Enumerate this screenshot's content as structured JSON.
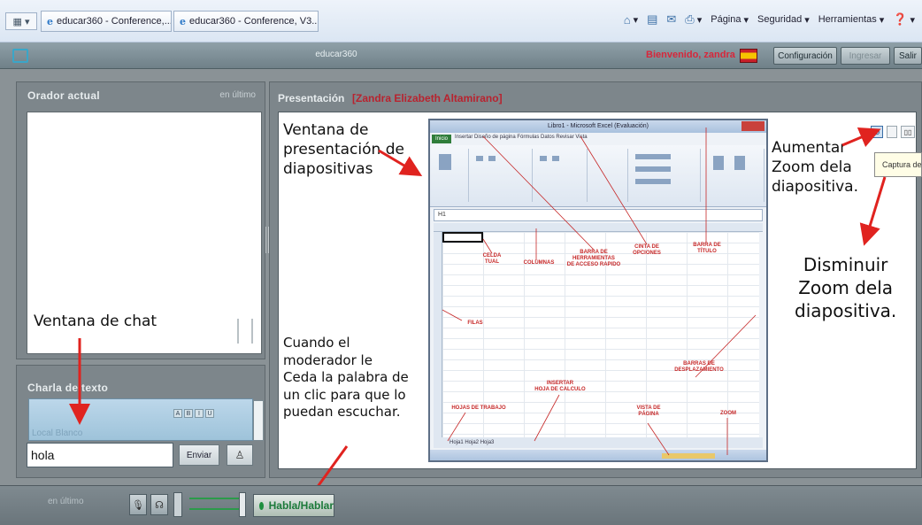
{
  "browser": {
    "tabs": [
      {
        "label": "educar360 - Conference,...",
        "close": "×"
      },
      {
        "label": "educar360 - Conference, V3..."
      }
    ],
    "commands": {
      "page": "Página",
      "security": "Seguridad",
      "tools": "Herramientas"
    }
  },
  "header": {
    "app_name": "educar360",
    "welcome": "Bienvenido, zandra",
    "settings_label": "Configuración",
    "button2_label": "Ingresar",
    "exit_label": "Salir"
  },
  "current_speaker": {
    "title": "Orador actual",
    "status": "en último"
  },
  "chat": {
    "title": "Charla de texto",
    "placeholder": "Local Blanco",
    "input_value": "hola",
    "send_label": "Enviar",
    "toolbar": [
      "A",
      "B",
      "I",
      "U"
    ]
  },
  "presentation": {
    "title": "Presentación",
    "presenter": "[Zandra Elizabeth Altamirano]",
    "tooltip": "Captura de"
  },
  "slide": {
    "window_title": "Libro1 - Microsoft Excel (Evaluación)",
    "home_tab": "Inicio",
    "tabs": "Insertar   Diseño de página   Fórmulas   Datos   Revisar   Vista",
    "name_box": "H1",
    "sheet_tabs": "Hoja1   Hoja2   Hoja3",
    "labels": {
      "celda": "CELDA\nTUAL",
      "columnas": "COLUMNAS",
      "barra_acceso": "BARRA DE\nHERRAMIENTAS\nDE ACCESO RAPIDO",
      "cinta": "CINTA DE\nOPCIONES",
      "barra_titulo": "BARRA DE\nTÍTULO",
      "filas": "FILAS",
      "desplazamiento": "BARRAS DE\nDESPLAZAMIENTO",
      "insertar": "INSERTAR\nHOJA DE CALCULO",
      "hojas": "HOJAS DE TRABAJO",
      "vista": "VISTA DE\nPÁGINA",
      "zoom": "ZOOM"
    }
  },
  "annotations": {
    "slide_window": "Ventana de\npresentación de\ndiapositivas",
    "zoom_in": "Aumentar\nZoom dela\ndiapositiva.",
    "zoom_out": "Disminuir\nZoom dela\ndiapositiva.",
    "chat_window": "Ventana de chat",
    "moderator": "Cuando el\nmoderador le\nCeda la palabra de\nun clic para que lo\npuedan escuchar.",
    "arrow_color": "#e0231f"
  },
  "bottom": {
    "status": "en último",
    "hand_label": "Habla/Hablar"
  }
}
